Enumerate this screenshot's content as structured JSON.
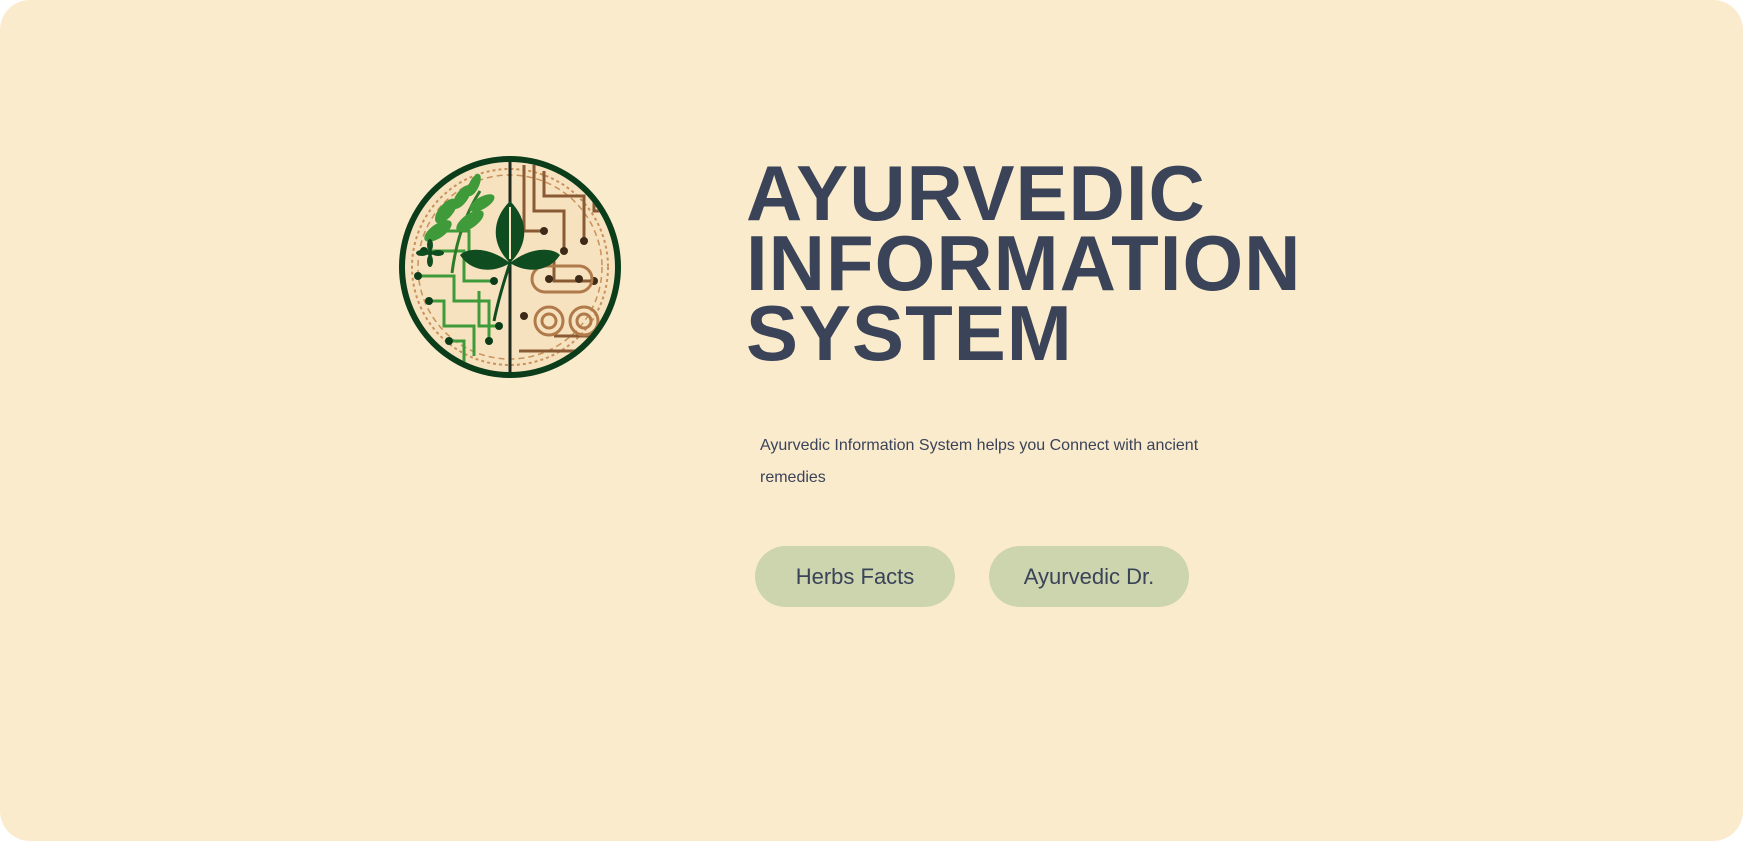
{
  "hero": {
    "title_lines": [
      "AYURVEDIC",
      "INFORMATION",
      "SYSTEM"
    ],
    "description": "Ayurvedic Information System helps you Connect with ancient remedies"
  },
  "buttons": {
    "herbs_facts": "Herbs Facts",
    "ayurvedic_dr": "Ayurvedic Dr."
  },
  "logo": {
    "icon": "leaf-circuit-logo",
    "colors": {
      "ring": "#0b3d1a",
      "background": "#f6e2bf",
      "leaf_green": "#3f9a3a",
      "circuit_brown": "#b07a4a",
      "dark_leaf": "#0f4d20"
    }
  },
  "theme": {
    "background": "#faebcd",
    "text": "#3a4358",
    "button": "#ccd5ae"
  }
}
